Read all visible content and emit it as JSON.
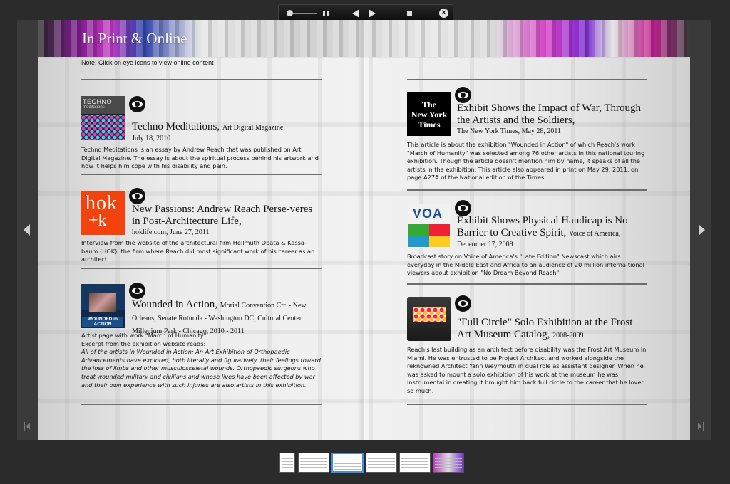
{
  "toolbar": {
    "close_glyph": "×"
  },
  "page": {
    "title": "In Print & Online",
    "note": "Note: Click on eye icons to view online content"
  },
  "left_items": [
    {
      "title": "Techno Meditations,",
      "source": "Art Digital Magazine,",
      "sub": "July 18, 2010",
      "body": "Techno Meditations is an essay by Andrew Reach that was published on Art Digital Magazine. The essay is about the spiritual process behind his artwork and how it helps him cope with his disability and pain.",
      "thumb_text_1": "TECHNO",
      "thumb_text_2": "meditations"
    },
    {
      "title": "New Passions: Andrew Reach Perse-veres in Post-Architecture Life,",
      "sub": "hoklife.com, June 27, 2011",
      "body": "Interview from the website of the architectural firm Hellmuth Obata & Kassa-baum (HOK), the firm where Reach did most significant work of his career as an architect.",
      "thumb_text_1": "hok",
      "thumb_text_2": "+k"
    },
    {
      "title": "Wounded in Action,",
      "source": "Morial Convention Ctr. - New Orleans, Senate Rotunda - Washington DC, Cultural Center Millenium Park - Chicago, 2010 - 2011",
      "body_1": "Artist page with  work \"March of Humanity\".",
      "body_2": "Excerpt from the exhibition website reads:",
      "body_italic": "All of the artists in Wounded in Action: An Art Exhibition of Orthopaedic Advancements have explored, both literally and figuratively, their feelings toward the loss of limbs and other musculoskeletal wounds.  Orthopaedic surgeons who treat wounded military and civilians and whose lives have been affected by war and their own experience with such injuries are also artists in this exhibition.",
      "thumb_text_1": "WOUNDED in ACTION"
    }
  ],
  "right_items": [
    {
      "title": "Exhibit Shows the Impact of War, Through the Artists and the Soldiers,",
      "sub": "The New York Times, May 28, 2011",
      "body": "This article is about the exhibition \"Wounded in Action\" of which Reach's work \"March of Humanity\" was selected among 76 other artists in this national touring exhibition. Though the article doesn't mention him by name, it speaks of all the artists in the exhibition. This article also appeared in print on May 29, 2011, on page A27A of the National edition of the Times.",
      "thumb_text_1": "The",
      "thumb_text_2": "New York",
      "thumb_text_3": "Times"
    },
    {
      "title": "Exhibit Shows Physical Handicap is No Barrier to Creative Spirit,",
      "source": "Voice of America,",
      "sub": "December 17, 2009",
      "body": "Broadcast story on Voice of America's \"Late Edition\" Newscast which airs everyday in the Middle East and Africa to an audience of 20 million interna-tional viewers about exhibition \"No Dream Beyond Reach\".",
      "thumb_text_1": "VOA"
    },
    {
      "title": "\"Full Circle\" Solo Exhibition at the Frost Art Museum Catalog,",
      "source": "2008-2009",
      "body": "Reach's last building as an architect before disability was the Frost Art Museum in Miami. He was entrusted to be Project Architect and worked alongside the reknowned Architect Yann Weymouth in dual role as assistant designer. When he was asked to mount a solo exhibition of his work at the museum he was instrumental in creating it brought him back full circle to the career that he loved so much."
    }
  ],
  "thumbnail_strip": {
    "active_index": 2,
    "count": 6
  }
}
